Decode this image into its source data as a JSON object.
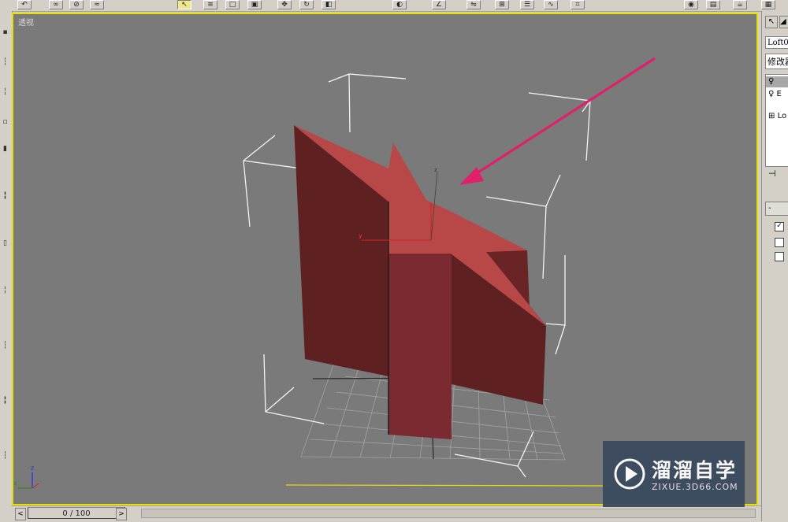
{
  "viewport": {
    "label": "透视",
    "axis_x": "y",
    "axis_z": "z",
    "tripod_x": "x",
    "tripod_z": "z"
  },
  "right_panel": {
    "object_name": "Loft0",
    "modifier_dropdown": "修改器",
    "stack_items": [
      {
        "icon": "bulb-icon",
        "label": ""
      },
      {
        "icon": "bulb-icon",
        "label": "E"
      },
      {
        "icon": "plus-icon",
        "label": "Lo"
      }
    ],
    "rollout_toggle": "-"
  },
  "timeline": {
    "frame_readout": "0 / 100",
    "prev_arrow": "<",
    "next_arrow": ">"
  },
  "watermark": {
    "title": "溜溜自学",
    "url": "ZIXUE.3D66.COM"
  },
  "colors": {
    "viewport_bg": "#7a7a7a",
    "active_border": "#e8e000",
    "star_face": "#b84848",
    "star_side_dark": "#5e2020",
    "star_side_mid": "#7a2a30",
    "arrow": "#e0206a",
    "bbox_lines": "#ffffff"
  }
}
